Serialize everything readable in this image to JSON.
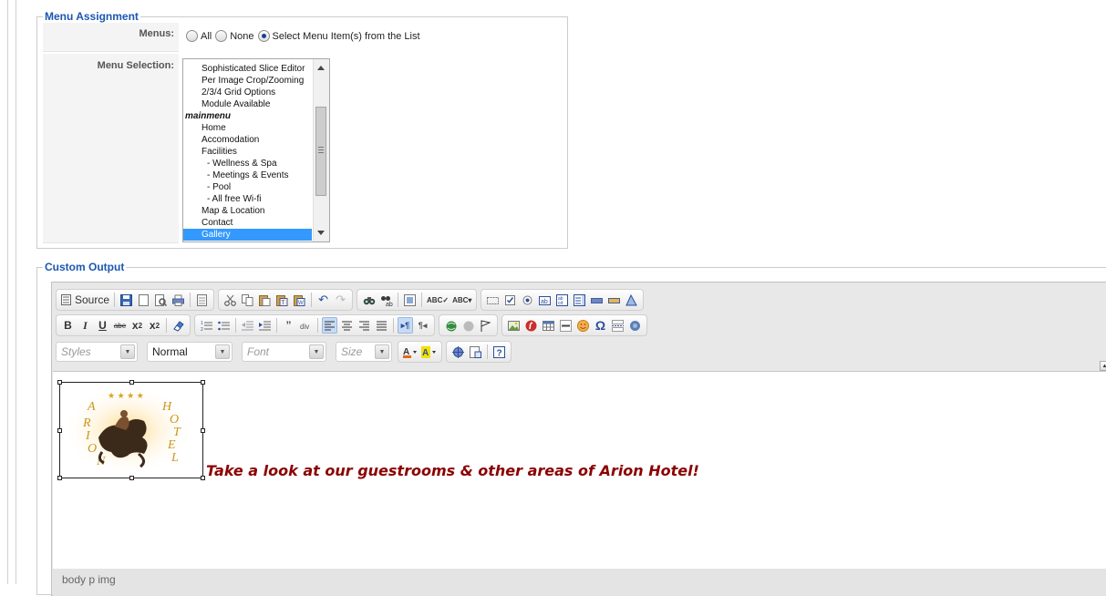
{
  "menu_assignment": {
    "legend": "Menu Assignment",
    "menus_label": "Menus:",
    "radio_options": [
      "All",
      "None",
      "Select Menu Item(s) from the List"
    ],
    "selected_radio": "Select Menu Item(s) from the List",
    "selection_label": "Menu Selection:",
    "list_items": [
      {
        "label": "Sophisticated Slice Editor",
        "kind": "item"
      },
      {
        "label": "Per Image Crop/Zooming",
        "kind": "item"
      },
      {
        "label": "2/3/4 Grid Options",
        "kind": "item"
      },
      {
        "label": "Module Available",
        "kind": "item"
      },
      {
        "label": "mainmenu",
        "kind": "group"
      },
      {
        "label": "Home",
        "kind": "item"
      },
      {
        "label": "Accomodation",
        "kind": "item"
      },
      {
        "label": "Facilities",
        "kind": "item"
      },
      {
        "label": "- Wellness & Spa",
        "kind": "sub"
      },
      {
        "label": "- Meetings & Events",
        "kind": "sub"
      },
      {
        "label": "- Pool",
        "kind": "sub"
      },
      {
        "label": "- All free Wi-fi",
        "kind": "sub"
      },
      {
        "label": "Map & Location",
        "kind": "item"
      },
      {
        "label": "Contact",
        "kind": "item"
      },
      {
        "label": "Gallery",
        "kind": "selected"
      }
    ]
  },
  "custom_output": {
    "legend": "Custom Output",
    "toolbar": {
      "source_label": "Source",
      "styles_placeholder": "Styles",
      "format_value": "Normal",
      "font_placeholder": "Font",
      "size_placeholder": "Size"
    },
    "content": {
      "caption": "Take a look at our guestrooms & other areas of Arion Hotel!",
      "logo_letters": [
        "A",
        "R",
        "I",
        "O",
        "N",
        "H",
        "O",
        "T",
        "E",
        "L"
      ]
    },
    "status_path": "body  p  img"
  },
  "colors": {
    "legend": "#1b57b1",
    "caption": "#8b0000",
    "list_selection": "#3399ff",
    "logo_gold": "#c9971c"
  }
}
